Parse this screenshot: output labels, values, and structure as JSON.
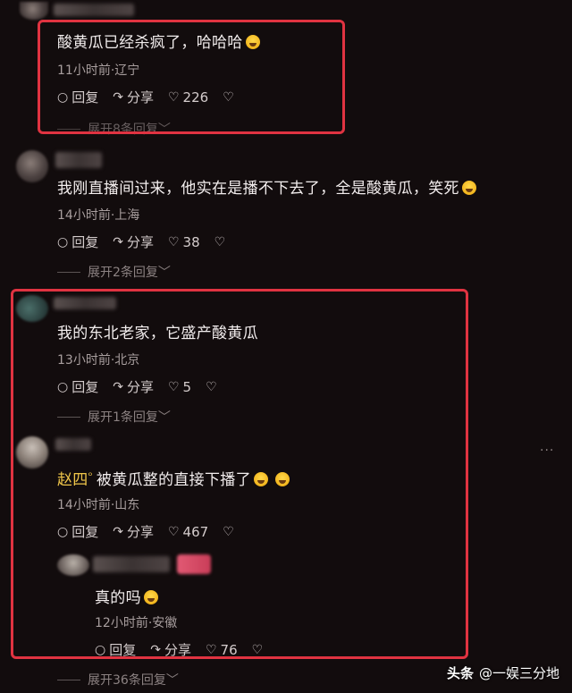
{
  "comments": [
    {
      "text": "酸黄瓜已经杀疯了，哈哈哈",
      "time": "11小时前·辽宁",
      "reply": "回复",
      "share": "分享",
      "likes": "226",
      "expand": "展开8条回复"
    },
    {
      "text": "我刚直播间过来，他实在是播不下去了，全是酸黄瓜，笑死",
      "time": "14小时前·上海",
      "reply": "回复",
      "share": "分享",
      "likes": "38",
      "expand": "展开2条回复"
    },
    {
      "text": "我的东北老家，它盛产酸黄瓜",
      "time": "13小时前·北京",
      "reply": "回复",
      "share": "分享",
      "likes": "5",
      "expand": "展开1条回复"
    },
    {
      "name": "赵四",
      "text": "被黄瓜整的直接下播了",
      "time": "14小时前·山东",
      "reply": "回复",
      "share": "分享",
      "likes": "467"
    }
  ],
  "sub_reply": {
    "text": "真的吗",
    "time": "12小时前·安徽",
    "reply": "回复",
    "share": "分享",
    "likes": "76",
    "expand": "展开36条回复"
  },
  "more_dots": "···",
  "watermark": {
    "brand": "头条",
    "account": "@一娱三分地"
  },
  "icons": {
    "reply": "reply-bubble-icon",
    "share": "share-arrow-icon",
    "like": "heart-icon",
    "dislike": "broken-heart-icon",
    "expand": "chevron-down-icon",
    "emoji": "laugh-cry-emoji-icon"
  },
  "colors": {
    "background": "#120c0d",
    "highlight_box": "#e03341",
    "name_highlight": "#f0c64a"
  }
}
